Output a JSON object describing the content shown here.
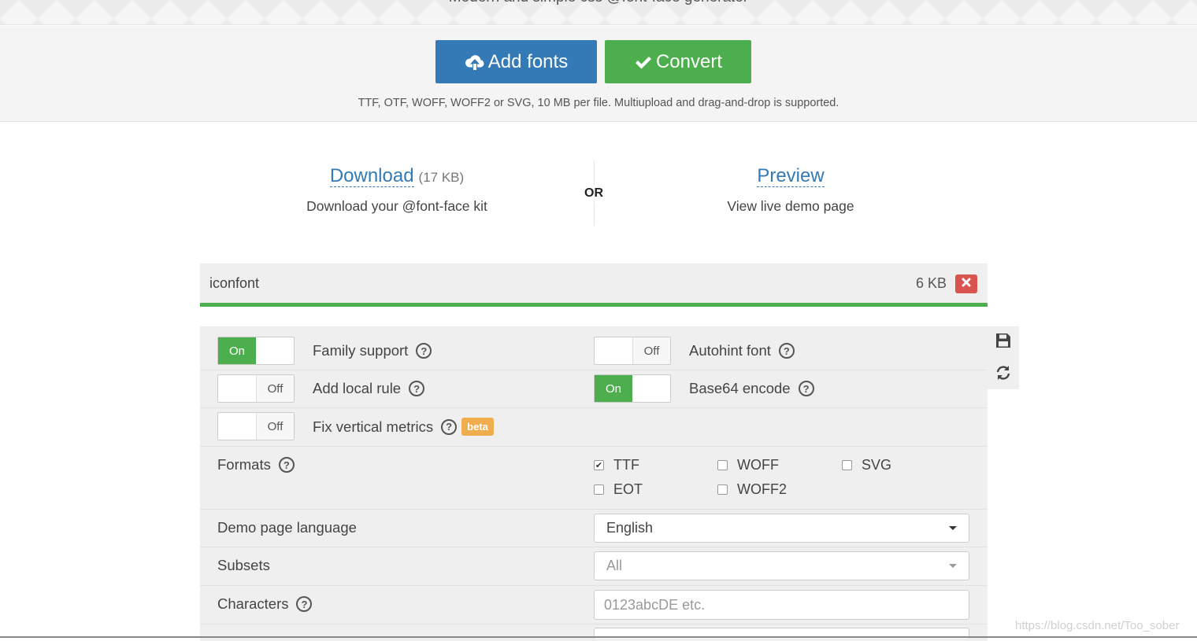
{
  "banner": {
    "tagline": "Modern and simple css @font-face generator"
  },
  "upload": {
    "add_fonts_label": "Add fonts",
    "convert_label": "Convert",
    "hint": "TTF, OTF, WOFF, WOFF2 or SVG, 10 MB per file. Multiupload and drag-and-drop is supported."
  },
  "download": {
    "link": "Download",
    "size": "(17 KB)",
    "subtitle": "Download your @font-face kit",
    "or": "OR",
    "preview_link": "Preview",
    "preview_subtitle": "View live demo page"
  },
  "file": {
    "name": "iconfont",
    "size": "6 KB",
    "progress_percent": 100
  },
  "options": {
    "family_support": {
      "label": "Family support",
      "state": "On"
    },
    "autohint_font": {
      "label": "Autohint font",
      "state": "Off"
    },
    "add_local_rule": {
      "label": "Add local rule",
      "state": "Off"
    },
    "base64_encode": {
      "label": "Base64 encode",
      "state": "On"
    },
    "fix_vertical_metrics": {
      "label": "Fix vertical metrics",
      "state": "Off",
      "badge": "beta"
    },
    "help_glyph": "?"
  },
  "formats": {
    "label": "Formats",
    "items": [
      {
        "name": "TTF",
        "checked": true
      },
      {
        "name": "WOFF",
        "checked": false
      },
      {
        "name": "SVG",
        "checked": false
      },
      {
        "name": "EOT",
        "checked": false
      },
      {
        "name": "WOFF2",
        "checked": false
      }
    ]
  },
  "demo_language": {
    "label": "Demo page language",
    "value": "English"
  },
  "subsets": {
    "label": "Subsets",
    "value": "All"
  },
  "characters": {
    "label": "Characters",
    "placeholder": "0123abcDE etc."
  },
  "watermark": "https://blog.csdn.net/Too_sober",
  "colors": {
    "primary": "#337ab7",
    "success": "#4cae4c",
    "danger": "#d9534f",
    "warning": "#f0ad4e"
  },
  "icons": [
    "cloud-upload-icon",
    "check-icon",
    "close-icon",
    "save-icon",
    "refresh-icon",
    "help-icon"
  ]
}
